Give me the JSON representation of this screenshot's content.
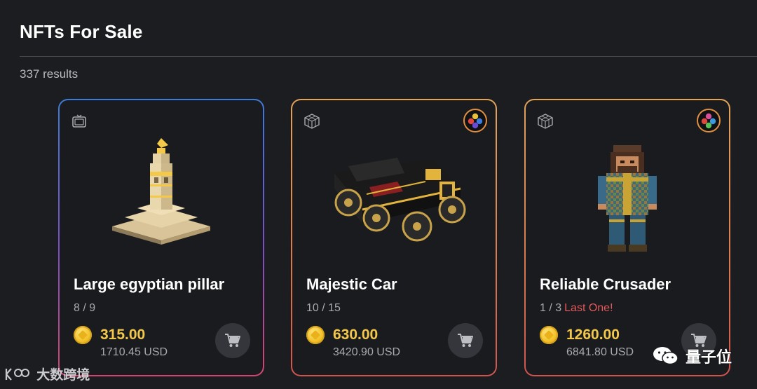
{
  "header": {
    "title": "NFTs For Sale",
    "results": "337 results"
  },
  "cards": [
    {
      "name": "Large egyptian pillar",
      "edition": "8 / 9",
      "last_label": "",
      "price": "315.00",
      "usd": "1710.45 USD",
      "type_icon": "tv-icon",
      "has_brand_badge": false
    },
    {
      "name": "Majestic Car",
      "edition": "10 / 15",
      "last_label": "",
      "price": "630.00",
      "usd": "3420.90 USD",
      "type_icon": "cube-grid-icon",
      "has_brand_badge": true
    },
    {
      "name": "Reliable Crusader",
      "edition": "1 / 3",
      "last_label": "Last One!",
      "price": "1260.00",
      "usd": "6841.80 USD",
      "type_icon": "cube-grid-icon",
      "has_brand_badge": true
    }
  ],
  "watermarks": {
    "left": "大数跨境",
    "right": "量子位"
  },
  "colors": {
    "background": "#1c1d21",
    "price": "#f3c74a",
    "last_one": "#e25a5a",
    "border_orange": "#e2a35a",
    "border_gradient_top": "#3f7bd6",
    "border_gradient_bottom": "#d2466e"
  }
}
